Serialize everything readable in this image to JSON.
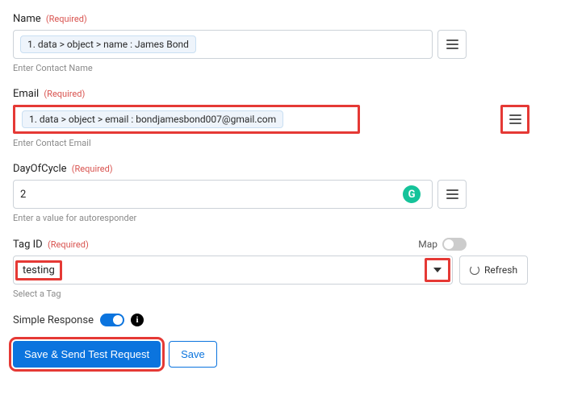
{
  "name": {
    "label": "Name",
    "required": "(Required)",
    "token": "1. data > object > name : James Bond",
    "helper": "Enter Contact Name"
  },
  "email": {
    "label": "Email",
    "required": "(Required)",
    "token": "1. data > object > email : bondjamesbond007@gmail.com",
    "helper": "Enter Contact Email"
  },
  "dayofcycle": {
    "label": "DayOfCycle",
    "required": "(Required)",
    "value": "2",
    "helper": "Enter a value for autoresponder"
  },
  "tagid": {
    "label": "Tag ID",
    "required": "(Required)",
    "map_label": "Map",
    "value": "testing",
    "refresh": "Refresh",
    "helper": "Select a Tag"
  },
  "simple_response": {
    "label": "Simple Response"
  },
  "buttons": {
    "primary": "Save & Send Test Request",
    "save": "Save"
  }
}
